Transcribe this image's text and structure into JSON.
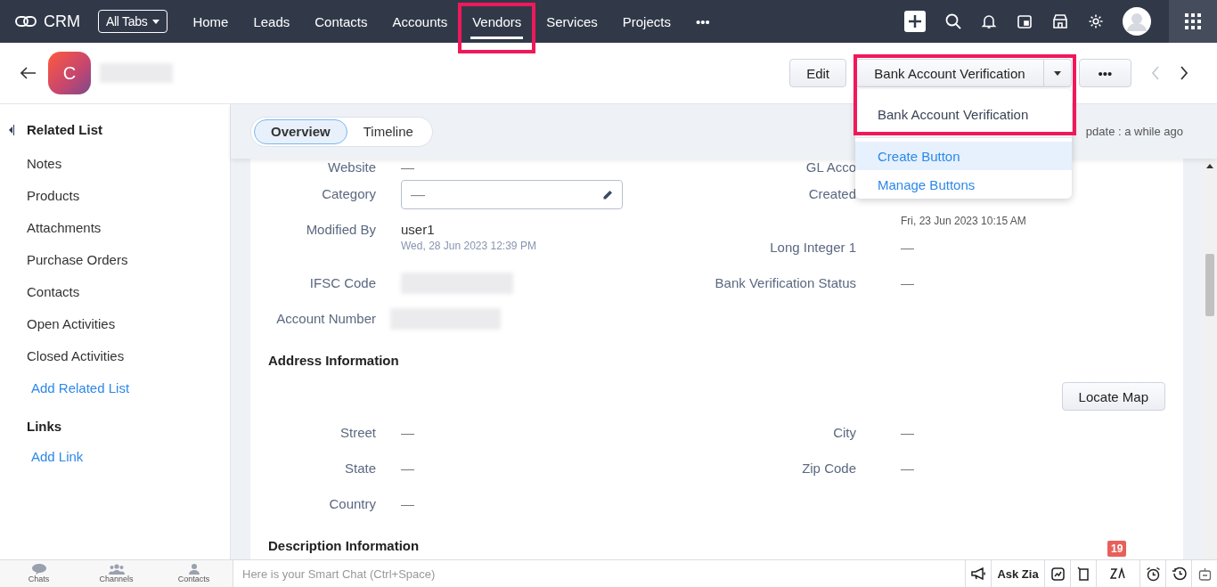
{
  "nav": {
    "app_name": "CRM",
    "all_tabs": "All Tabs",
    "more": "•••",
    "tabs": [
      {
        "label": "Home",
        "selected": false,
        "highlighted": false
      },
      {
        "label": "Leads",
        "selected": false,
        "highlighted": false
      },
      {
        "label": "Contacts",
        "selected": false,
        "highlighted": false
      },
      {
        "label": "Accounts",
        "selected": false,
        "highlighted": false
      },
      {
        "label": "Vendors",
        "selected": true,
        "highlighted": true
      },
      {
        "label": "Services",
        "selected": false,
        "highlighted": false
      },
      {
        "label": "Projects",
        "selected": false,
        "highlighted": false
      }
    ]
  },
  "record": {
    "avatar_letter": "C",
    "edit": "Edit",
    "primary": "Bank Account Verification",
    "more": "•••",
    "highlighted": true,
    "dropdown": [
      {
        "label": "Bank Account Verification",
        "kind": "action",
        "selected": false
      },
      {
        "label": "Create Button",
        "kind": "link",
        "selected": true
      },
      {
        "label": "Manage Buttons",
        "kind": "link",
        "selected": false
      }
    ]
  },
  "sidebar": {
    "heading": "Related List",
    "items": [
      "Notes",
      "Products",
      "Attachments",
      "Purchase Orders",
      "Contacts",
      "Open Activities",
      "Closed Activities"
    ],
    "add_related": "Add Related List",
    "links_heading": "Links",
    "add_link": "Add Link"
  },
  "view_tabs": [
    {
      "label": "Overview",
      "selected": true
    },
    {
      "label": "Timeline",
      "selected": false
    }
  ],
  "last_update": "pdate : a while ago",
  "details": {
    "left": [
      {
        "label": "Website",
        "kind": "text",
        "value": "—"
      },
      {
        "label": "Category",
        "kind": "input",
        "value": "—"
      },
      {
        "label": "Modified By",
        "kind": "user",
        "value": "user1",
        "date": "Wed, 28 Jun 2023 12:39 PM"
      },
      {
        "label": "IFSC Code",
        "kind": "blurred"
      },
      {
        "label": "Account Number",
        "kind": "blurred"
      }
    ],
    "right": [
      {
        "label": "GL Acco",
        "kind": "text"
      },
      {
        "label": "Created",
        "kind": "user",
        "date": "Fri, 23 Jun 2023 10:15 AM"
      },
      {
        "label": "Long Integer 1",
        "kind": "text",
        "value": "—"
      },
      {
        "label": "Bank Verification Status",
        "kind": "text",
        "value": "—"
      }
    ]
  },
  "address": {
    "heading": "Address Information",
    "locate": "Locate Map",
    "fields": [
      {
        "label": "Street",
        "value": "—"
      },
      {
        "label": "City",
        "value": "—"
      },
      {
        "label": "State",
        "value": "—"
      },
      {
        "label": "Zip Code",
        "value": "—"
      },
      {
        "label": "Country",
        "value": "—"
      }
    ]
  },
  "description_heading": "Description Information",
  "bottom_bar": {
    "left": [
      {
        "label": "Chats",
        "kind": "chats"
      },
      {
        "label": "Channels",
        "kind": "channels"
      },
      {
        "label": "Contacts",
        "kind": "contacts"
      }
    ],
    "chat_placeholder": "Here is your Smart Chat (Ctrl+Space)",
    "tools": [
      {
        "kind": "megaphone"
      },
      {
        "kind": "text",
        "label": "Ask Zia"
      },
      {
        "kind": "chart"
      },
      {
        "kind": "note"
      },
      {
        "kind": "zia",
        "badge": "19"
      },
      {
        "kind": "alarm"
      },
      {
        "kind": "history"
      },
      {
        "kind": "bot"
      }
    ]
  }
}
